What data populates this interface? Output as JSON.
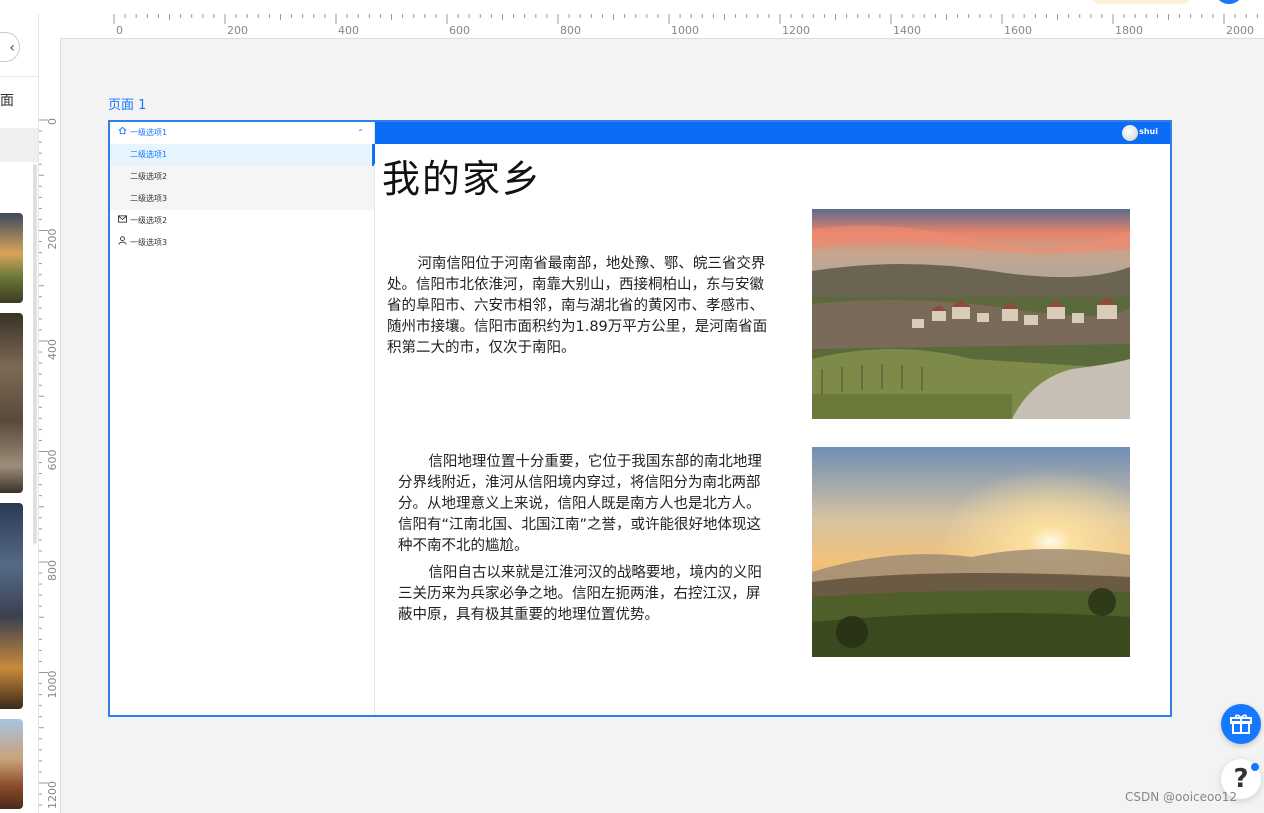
{
  "leftpanel": {
    "back_icon": "‹",
    "label": "面"
  },
  "ruler": {
    "h_labels": [
      "0",
      "200",
      "400",
      "600",
      "800",
      "1000",
      "1200",
      "1400",
      "1600",
      "1800",
      "2000"
    ],
    "v_labels": [
      "0",
      "200",
      "400",
      "600",
      "800",
      "1000",
      "1200"
    ]
  },
  "page": {
    "label": "页面 1"
  },
  "menu": {
    "items": [
      {
        "label": "一级选项1",
        "icon": "home-icon"
      },
      {
        "label": "二级选项1"
      },
      {
        "label": "二级选项2"
      },
      {
        "label": "二级选项3"
      },
      {
        "label": "一级选项2",
        "icon": "mail-icon"
      },
      {
        "label": "一级选项3",
        "icon": "user-icon"
      }
    ],
    "caret": "⌃"
  },
  "header": {
    "user_name": "shui"
  },
  "content": {
    "title": "我的家乡",
    "para1": "河南信阳位于河南省最南部，地处豫、鄂、皖三省交界处。信阳市北依淮河，南靠大别山，西接桐柏山，东与安徽省的阜阳市、六安市相邻，南与湖北省的黄冈市、孝感市、随州市接壤。信阳市面积约为1.89万平方公里，是河南省面积第二大的市，仅次于南阳。",
    "para2": "信阳地理位置十分重要，它位于我国东部的南北地理分界线附近，淮河从信阳境内穿过，将信阳分为南北两部分。从地理意义上来说，信阳人既是南方人也是北方人。信阳有“江南北国、北国江南”之誉，或许能很好地体现这种不南不北的尴尬。",
    "para3": "信阳自古以来就是江淮河汉的战略要地，境内的义阳三关历来为兵家必争之地。信阳左扼两淮，右控江汉，屏蔽中原，具有极其重要的地理位置优势。"
  },
  "fab": {
    "help": "?"
  },
  "watermark": "CSDN @ooiceoo12",
  "colors": {
    "accent": "#1677ff",
    "header": "#0b6cf5"
  }
}
